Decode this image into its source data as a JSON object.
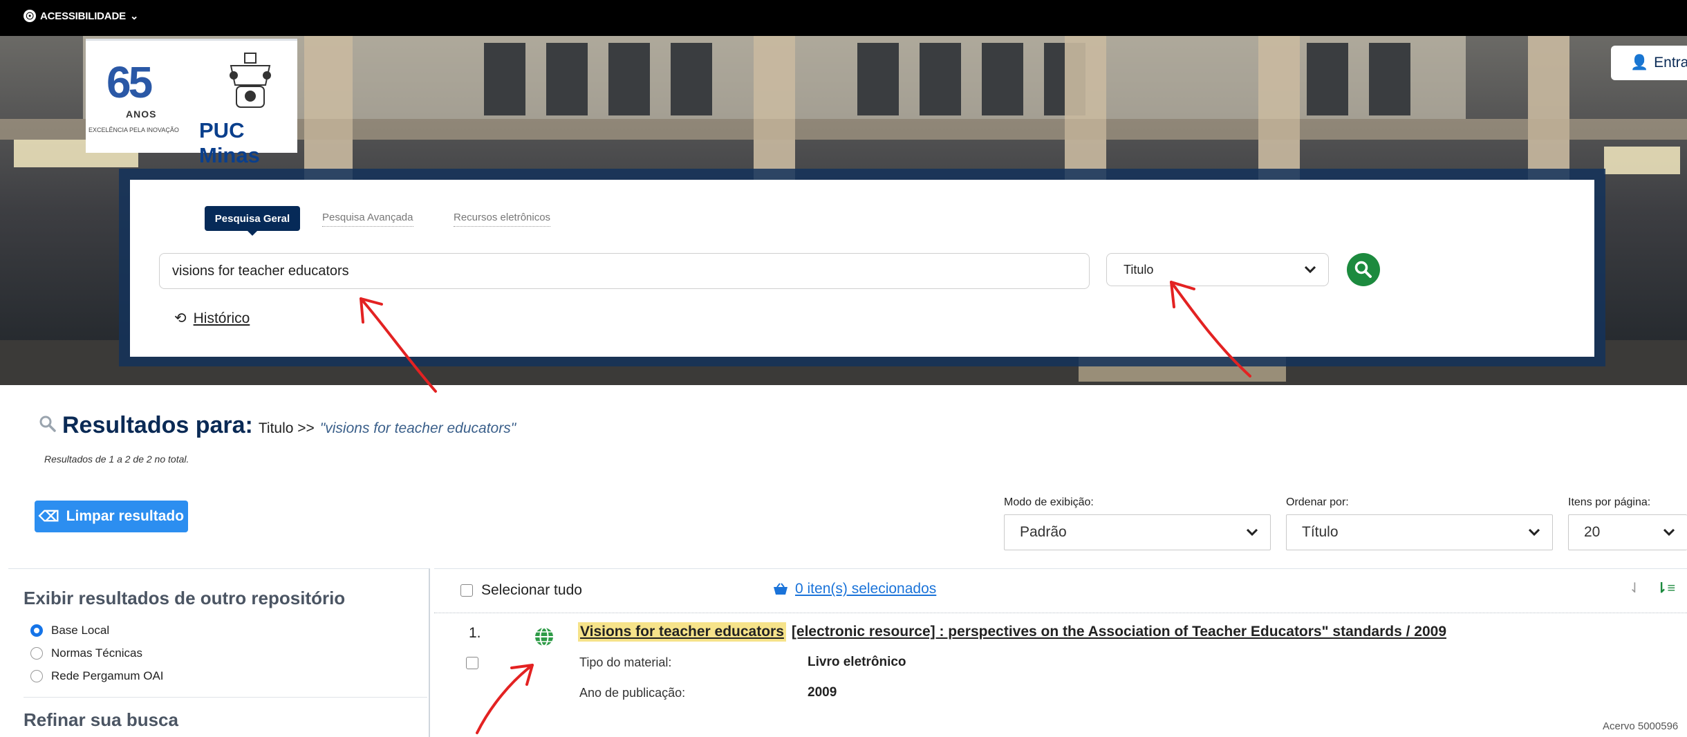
{
  "topbar": {
    "accessibility_label": "ACESSIBILIDADE"
  },
  "header": {
    "logo_number": "65",
    "logo_anos": "ANOS",
    "logo_tagline": "EXCELÊNCIA PELA INOVAÇÃO",
    "logo_name": "PUC Minas",
    "login_label": "Entra"
  },
  "search": {
    "tabs": [
      {
        "label": "Pesquisa Geral"
      },
      {
        "label": "Pesquisa Avançada"
      },
      {
        "label": "Recursos eletrônicos"
      }
    ],
    "query_value": "visions for teacher educators",
    "field_value": "Titulo",
    "history_label": "Histórico"
  },
  "results": {
    "heading": "Resultados para:",
    "field": "Titulo >>",
    "query": "\"visions for teacher educators\"",
    "count_text": "Resultados de 1 a 2 de 2 no total.",
    "clear_label": "Limpar resultado",
    "controls": [
      {
        "label": "Modo de exibição:",
        "value": "Padrão"
      },
      {
        "label": "Ordenar por:",
        "value": "Título"
      },
      {
        "label": "Itens por página:",
        "value": "20"
      }
    ]
  },
  "sidebar": {
    "repo_heading": "Exibir resultados de outro repositório",
    "repos": [
      {
        "label": "Base Local",
        "selected": true
      },
      {
        "label": "Normas Técnicas",
        "selected": false
      },
      {
        "label": "Rede Pergamum OAI",
        "selected": false
      }
    ],
    "refine_heading": "Refinar sua busca"
  },
  "list": {
    "select_all_label": "Selecionar tudo",
    "selected_count_label": "0 iten(s) selecionados",
    "items": [
      {
        "number": "1.",
        "title_highlight": "Visions for teacher educators",
        "title_rest": "[electronic resource] : perspectives on the Association of Teacher Educators\" standards / 2009",
        "material_label": "Tipo do material:",
        "material_value": "Livro eletrônico",
        "year_label": "Ano de publicação:",
        "year_value": "2009",
        "acervo": "Acervo 5000596"
      }
    ]
  },
  "colors": {
    "brand_navy": "#062a58",
    "accent_blue": "#2c8ef0",
    "search_green": "#1c8a3e",
    "highlight": "#f6e38a",
    "annotation_red": "#e32222"
  }
}
